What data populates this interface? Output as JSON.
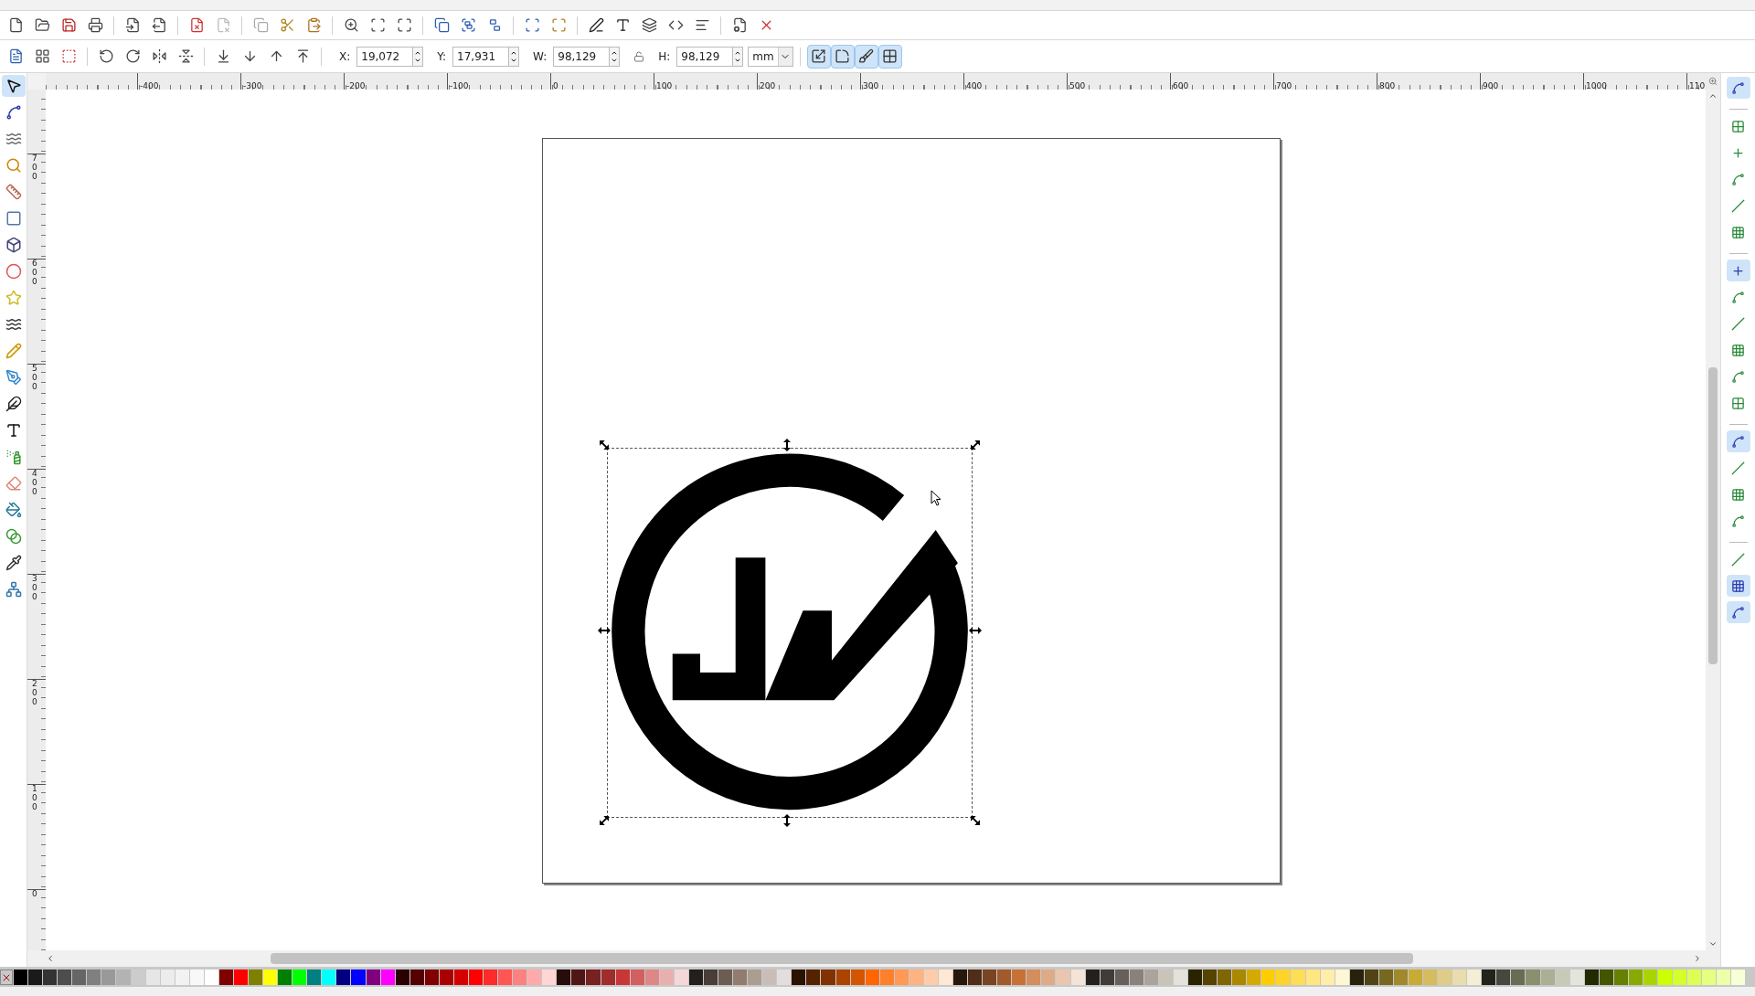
{
  "toolbox": {
    "tools": [
      {
        "selected": true
      },
      {
        "selected": false
      },
      {
        "selected": false
      },
      {
        "selected": false
      },
      {
        "selected": false
      },
      {
        "selected": false
      },
      {
        "selected": false
      },
      {
        "selected": false
      },
      {
        "selected": false
      },
      {
        "selected": false
      },
      {
        "selected": false
      },
      {
        "selected": false
      },
      {
        "selected": false
      },
      {
        "selected": false
      },
      {
        "selected": false
      },
      {
        "selected": false
      },
      {
        "selected": false
      },
      {
        "selected": false
      },
      {
        "selected": false
      },
      {
        "selected": false
      }
    ]
  },
  "tool_controls": {
    "fields": [
      {
        "label": "X:",
        "value": "19,072"
      },
      {
        "label": "Y:",
        "value": "17,931"
      },
      {
        "label": "W:",
        "value": "98,129"
      },
      {
        "label": "H:",
        "value": "98,129"
      }
    ],
    "unit": "mm",
    "transform_toggles": [
      {
        "on": true
      },
      {
        "on": true
      },
      {
        "on": true
      },
      {
        "on": true
      }
    ]
  },
  "rulers": {
    "horizontal": [
      "-400",
      "-300",
      "-200",
      "-100",
      "0",
      "100",
      "200",
      "300",
      "400",
      "500",
      "600",
      "700",
      "800",
      "900",
      "1000",
      "110"
    ],
    "vertical": [
      "700",
      "600",
      "500",
      "400",
      "300",
      "200",
      "100",
      "0"
    ]
  },
  "snap_toolbar": {
    "groups": [
      [
        {
          "on": true
        }
      ],
      [
        {
          "on": false
        },
        {
          "on": false
        },
        {
          "on": false
        },
        {
          "on": false
        },
        {
          "on": false
        }
      ],
      [
        {
          "on": true
        },
        {
          "on": false
        },
        {
          "on": false
        },
        {
          "on": false
        },
        {
          "on": false
        },
        {
          "on": false
        }
      ],
      [
        {
          "on": true
        },
        {
          "on": false
        },
        {
          "on": false
        },
        {
          "on": false
        }
      ],
      [
        {
          "on": false
        },
        {
          "on": true
        },
        {
          "on": true
        }
      ]
    ]
  },
  "palette": {
    "swatches": [
      {
        "color": "#000000"
      },
      {
        "color": "#1a1a1a"
      },
      {
        "color": "#333333"
      },
      {
        "color": "#4d4d4d"
      },
      {
        "color": "#666666"
      },
      {
        "color": "#808080"
      },
      {
        "color": "#999999"
      },
      {
        "color": "#b3b3b3"
      },
      {
        "color": "#cccccc"
      },
      {
        "color": "#e6e6e6"
      },
      {
        "color": "#ececec"
      },
      {
        "color": "#f2f2f2"
      },
      {
        "color": "#f8f8f8"
      },
      {
        "color": "#ffffff"
      },
      {
        "color": "#800000"
      },
      {
        "color": "#ff0000"
      },
      {
        "color": "#808000"
      },
      {
        "color": "#ffff00"
      },
      {
        "color": "#008000"
      },
      {
        "color": "#00ff00"
      },
      {
        "color": "#008080"
      },
      {
        "color": "#00ffff"
      },
      {
        "color": "#000080"
      },
      {
        "color": "#0000ff"
      },
      {
        "color": "#800080"
      },
      {
        "color": "#ff00ff"
      },
      {
        "color": "#2b0000"
      },
      {
        "color": "#550000"
      },
      {
        "color": "#800001"
      },
      {
        "color": "#aa0000"
      },
      {
        "color": "#d40000"
      },
      {
        "color": "#ff0001"
      },
      {
        "color": "#ff2a2a"
      },
      {
        "color": "#ff5555"
      },
      {
        "color": "#ff8080"
      },
      {
        "color": "#ffaaaa"
      },
      {
        "color": "#ffd5d5"
      },
      {
        "color": "#280b0b"
      },
      {
        "color": "#501616"
      },
      {
        "color": "#782121"
      },
      {
        "color": "#a02c2c"
      },
      {
        "color": "#c83737"
      },
      {
        "color": "#d35f5f"
      },
      {
        "color": "#de8787"
      },
      {
        "color": "#e9afaf"
      },
      {
        "color": "#f4d7d7"
      },
      {
        "color": "#241f1c"
      },
      {
        "color": "#483e37"
      },
      {
        "color": "#6c5d53"
      },
      {
        "color": "#917c6f"
      },
      {
        "color": "#ac9d93"
      },
      {
        "color": "#c8beb7"
      },
      {
        "color": "#e3dedb"
      },
      {
        "color": "#2b1100"
      },
      {
        "color": "#552200"
      },
      {
        "color": "#803300"
      },
      {
        "color": "#aa4400"
      },
      {
        "color": "#d45500"
      },
      {
        "color": "#ff6600"
      },
      {
        "color": "#ff7f2a"
      },
      {
        "color": "#ff9955"
      },
      {
        "color": "#ffb380"
      },
      {
        "color": "#ffccaa"
      },
      {
        "color": "#ffe6d5"
      },
      {
        "color": "#28170b"
      },
      {
        "color": "#502d16"
      },
      {
        "color": "#784421"
      },
      {
        "color": "#a05a2c"
      },
      {
        "color": "#c87137"
      },
      {
        "color": "#d38d5f"
      },
      {
        "color": "#deaa87"
      },
      {
        "color": "#e9c6af"
      },
      {
        "color": "#f4e3d7"
      },
      {
        "color": "#22211d"
      },
      {
        "color": "#403c38"
      },
      {
        "color": "#67605a"
      },
      {
        "color": "#8a817c"
      },
      {
        "color": "#aca39d"
      },
      {
        "color": "#c8c4b7"
      },
      {
        "color": "#e3e2db"
      },
      {
        "color": "#2b2200"
      },
      {
        "color": "#554400"
      },
      {
        "color": "#806600"
      },
      {
        "color": "#aa8800"
      },
      {
        "color": "#d4aa00"
      },
      {
        "color": "#ffcc00"
      },
      {
        "color": "#ffd42a"
      },
      {
        "color": "#ffdd55"
      },
      {
        "color": "#ffe680"
      },
      {
        "color": "#ffeeaa"
      },
      {
        "color": "#fff6d5"
      },
      {
        "color": "#28220b"
      },
      {
        "color": "#504416"
      },
      {
        "color": "#786721"
      },
      {
        "color": "#a0892c"
      },
      {
        "color": "#c8ab37"
      },
      {
        "color": "#d4bc5f"
      },
      {
        "color": "#dfcd87"
      },
      {
        "color": "#e9ddaf"
      },
      {
        "color": "#f4eed7"
      },
      {
        "color": "#22241c"
      },
      {
        "color": "#45483e"
      },
      {
        "color": "#676c53"
      },
      {
        "color": "#898f6f"
      },
      {
        "color": "#abaf93"
      },
      {
        "color": "#c8cab7"
      },
      {
        "color": "#e3e4db"
      },
      {
        "color": "#222b00"
      },
      {
        "color": "#445500"
      },
      {
        "color": "#668000"
      },
      {
        "color": "#88aa00"
      },
      {
        "color": "#aad400"
      },
      {
        "color": "#ccff00"
      },
      {
        "color": "#d4ff2a"
      },
      {
        "color": "#ddff55"
      },
      {
        "color": "#e5ff80"
      },
      {
        "color": "#eeffaa"
      },
      {
        "color": "#f6ffd5"
      }
    ]
  }
}
